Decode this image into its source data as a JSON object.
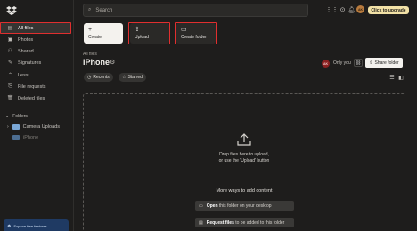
{
  "sidebar": {
    "items": [
      {
        "label": "All files",
        "icon": "files-icon"
      },
      {
        "label": "Photos",
        "icon": "photos-icon"
      },
      {
        "label": "Shared",
        "icon": "shared-icon"
      },
      {
        "label": "Signatures",
        "icon": "signature-icon"
      },
      {
        "label": "Less",
        "icon": "chevron-up-icon"
      },
      {
        "label": "File requests",
        "icon": "file-request-icon"
      },
      {
        "label": "Deleted files",
        "icon": "trash-icon"
      }
    ],
    "folders_heading": "Folders",
    "tree": [
      {
        "label": "Camera Uploads"
      },
      {
        "label": "iPhone"
      }
    ],
    "promo_text": "Explore free features"
  },
  "topbar": {
    "search_placeholder": "Search",
    "avatar_initials": "AK",
    "upgrade_label": "Click to upgrade"
  },
  "actions": {
    "create": "Create",
    "upload": "Upload",
    "create_folder": "Create folder"
  },
  "header": {
    "breadcrumb": "All files",
    "title": "iPhone",
    "member_initials": "AK",
    "access": "Only you",
    "share_label": "Share folder"
  },
  "filters": {
    "recents": "Recents",
    "starred": "Starred"
  },
  "dropzone": {
    "line1": "Drop files here to upload,",
    "line2": "or use the 'Upload' button",
    "more_ways": "More ways to add content",
    "way1_bold": "Open",
    "way1_rest": "this folder on your desktop",
    "way2_bold": "Request files",
    "way2_rest": "to be added to this folder"
  },
  "colors": {
    "highlight": "#e02f2f",
    "upgrade_bg": "#f2e1a6",
    "background": "#1e1d1c"
  }
}
